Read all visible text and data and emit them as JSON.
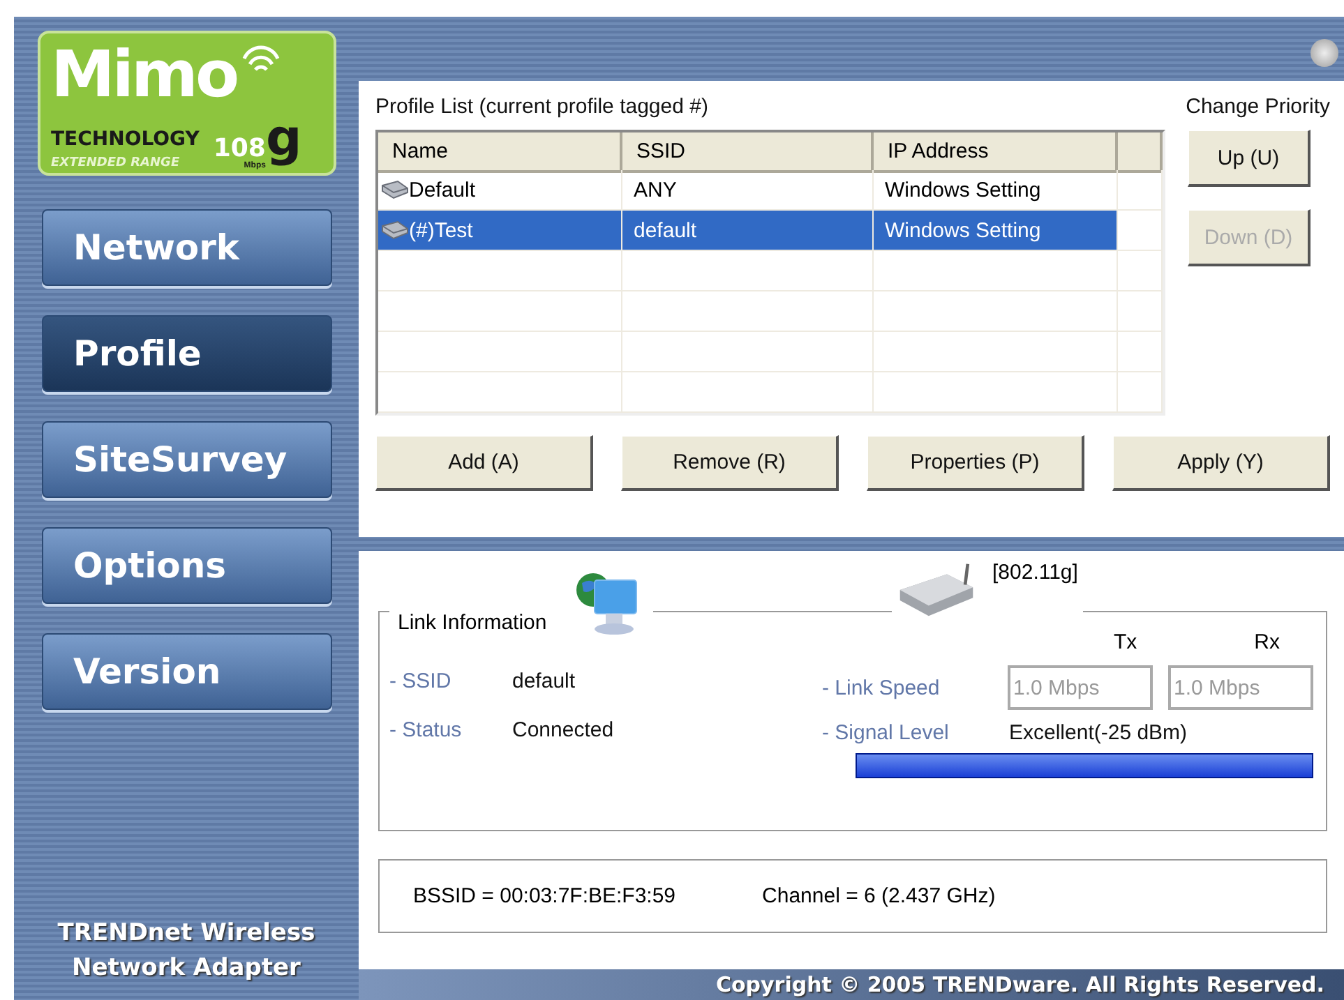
{
  "logo": {
    "brand": "Mimo",
    "tech": "TECHNOLOGY",
    "speed": "108",
    "speed_unit": "Mbps",
    "letter": "g",
    "range": "EXTENDED RANGE"
  },
  "sidebar": {
    "items": [
      {
        "label": "Network",
        "selected": false
      },
      {
        "label": "Profile",
        "selected": true
      },
      {
        "label": "SiteSurvey",
        "selected": false
      },
      {
        "label": "Options",
        "selected": false
      },
      {
        "label": "Version",
        "selected": false
      }
    ],
    "footer": [
      "TRENDnet Wireless",
      "Network Adapter"
    ]
  },
  "profile": {
    "title": "Profile List (current profile tagged #)",
    "priority_label": "Change Priority",
    "table": {
      "columns": [
        "Name",
        "SSID",
        "IP Address"
      ],
      "rows": [
        {
          "cells": [
            "Default",
            "ANY",
            "Windows Setting"
          ],
          "selected": false
        },
        {
          "cells": [
            "(#)Test",
            "default",
            "Windows Setting"
          ],
          "selected": true
        }
      ]
    },
    "priority_buttons": [
      {
        "label": "Up (U)",
        "disabled": false
      },
      {
        "label": "Down (D)",
        "disabled": true
      }
    ],
    "buttons": [
      "Add (A)",
      "Remove (R)",
      "Properties (P)",
      "Apply (Y)"
    ]
  },
  "link": {
    "title": "Link Information",
    "mode": "[802.11g]",
    "tx_label": "Tx",
    "rx_label": "Rx",
    "fields": [
      {
        "label": "- SSID",
        "value": "default"
      },
      {
        "label": "- Status",
        "value": "Connected"
      }
    ],
    "speed_label": "- Link Speed",
    "tx": "1.0 Mbps",
    "rx": "1.0 Mbps",
    "signal_label": "- Signal Level",
    "signal_value": "Excellent(-25 dBm)",
    "signal": {
      "level": 1
    }
  },
  "info": {
    "bssid": "BSSID = 00:03:7F:BE:F3:59",
    "channel": "Channel = 6 (2.437 GHz)"
  },
  "copyright": "Copyright © 2005 TRENDware. All Rights Reserved."
}
